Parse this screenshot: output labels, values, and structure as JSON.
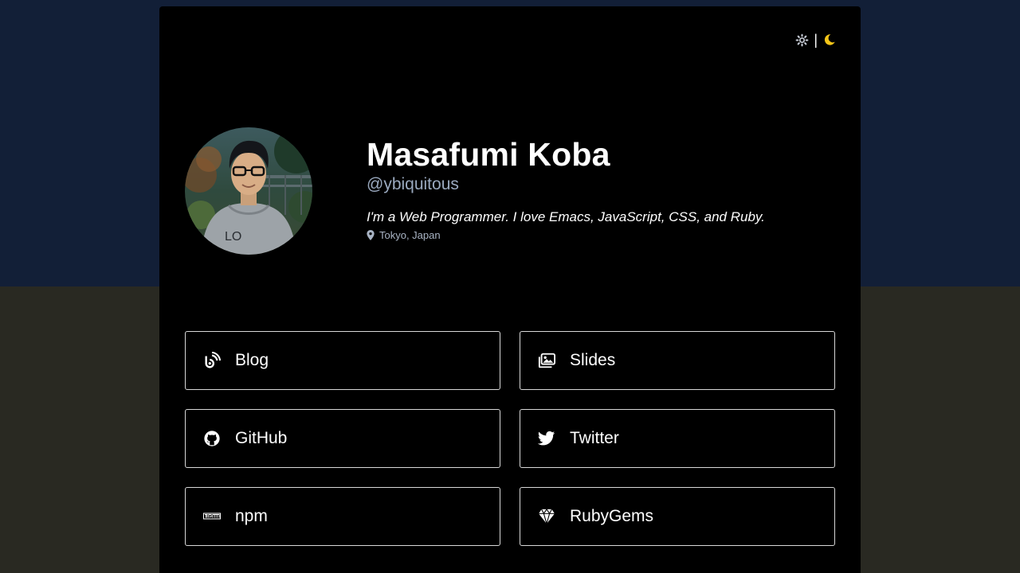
{
  "profile": {
    "name": "Masafumi Koba",
    "handle": "@ybiquitous",
    "bio": "I'm a Web Programmer. I love Emacs, JavaScript, CSS, and Ruby.",
    "location": "Tokyo, Japan"
  },
  "theme_switch": {
    "separator": "|",
    "light_icon": "gear-sun-icon",
    "dark_icon": "moon-icon",
    "active_color": "#f5c518"
  },
  "links": [
    {
      "label": "Blog",
      "icon": "blog-icon"
    },
    {
      "label": "Slides",
      "icon": "slides-icon"
    },
    {
      "label": "GitHub",
      "icon": "github-icon"
    },
    {
      "label": "Twitter",
      "icon": "twitter-icon"
    },
    {
      "label": "npm",
      "icon": "npm-icon"
    },
    {
      "label": "RubyGems",
      "icon": "rubygems-icon"
    }
  ],
  "colors": {
    "background_top": "#121f37",
    "background_bottom": "#292922",
    "card": "#000000",
    "text": "#ffffff",
    "muted": "#9aa9bf"
  }
}
